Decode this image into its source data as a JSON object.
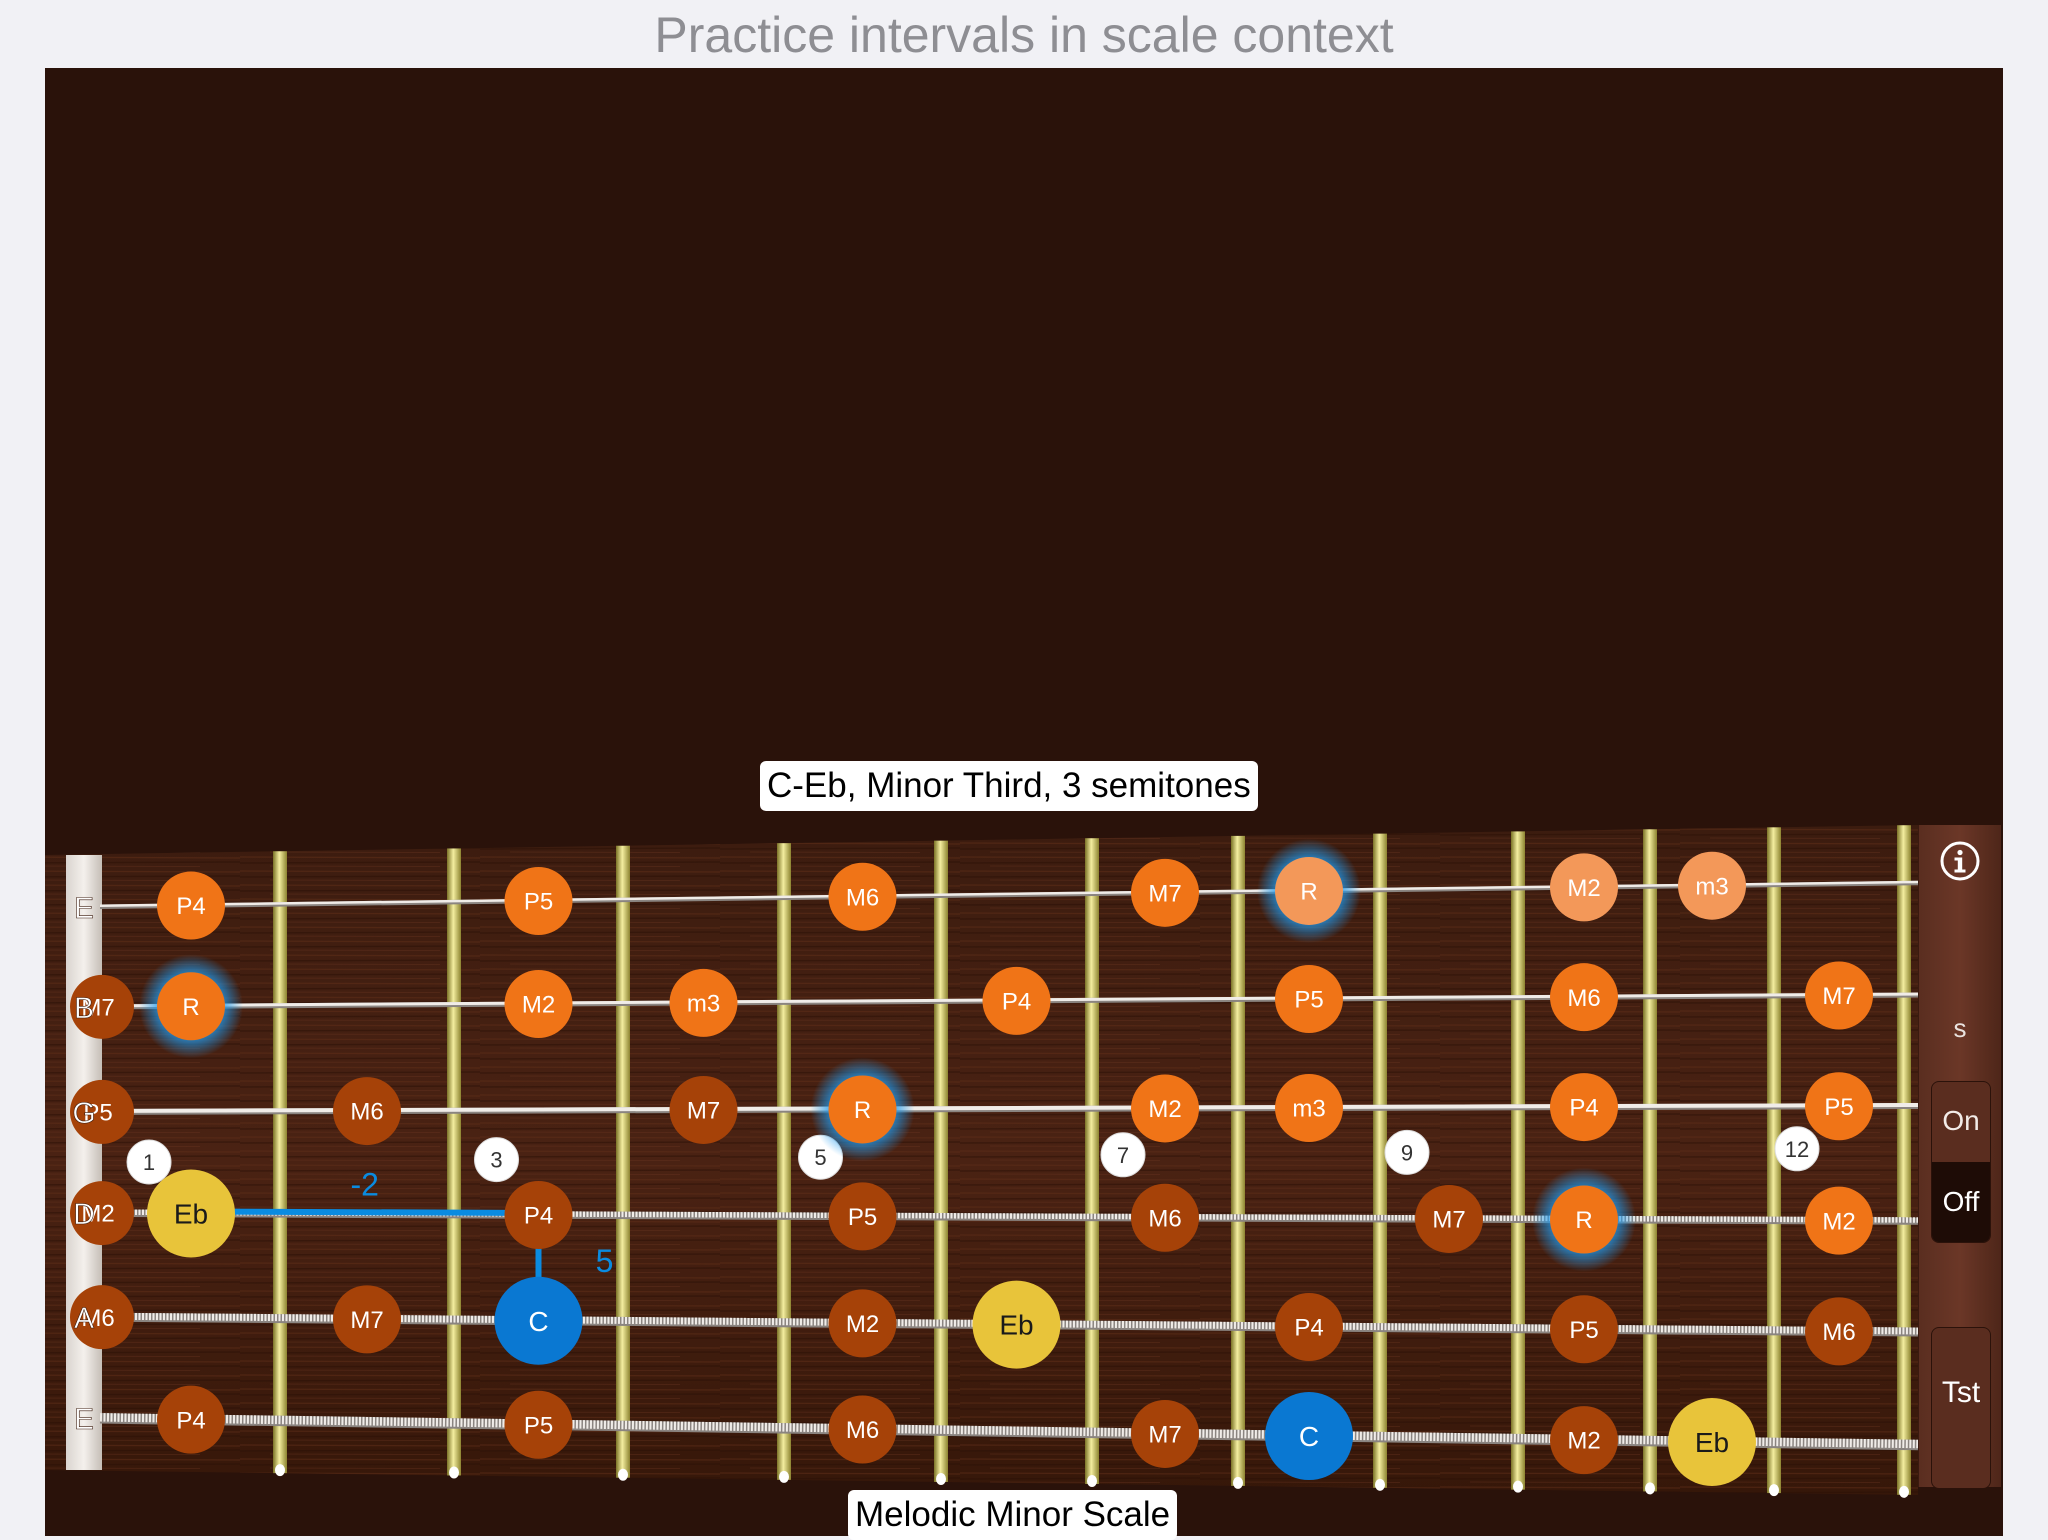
{
  "header": {
    "title": "Practice intervals in scale context"
  },
  "interval_caption": "C-Eb, Minor Third, 3 semitones",
  "scale_caption": "Melodic Minor Scale",
  "strings": [
    {
      "name": "E",
      "notes": [
        {
          "fret": 1,
          "label": "P4",
          "kind": "orange"
        },
        {
          "fret": 3,
          "label": "P5",
          "kind": "orange"
        },
        {
          "fret": 5,
          "label": "M6",
          "kind": "orange"
        },
        {
          "fret": 7,
          "label": "M7",
          "kind": "orange"
        },
        {
          "fret": 8,
          "label": "R",
          "kind": "root-light"
        },
        {
          "fret": 10,
          "label": "M2",
          "kind": "light"
        },
        {
          "fret": 11,
          "label": "m3",
          "kind": "light"
        }
      ]
    },
    {
      "name": "B",
      "notes": [
        {
          "fret": 0,
          "label": "M7",
          "kind": "nut"
        },
        {
          "fret": 1,
          "label": "R",
          "kind": "root"
        },
        {
          "fret": 3,
          "label": "M2",
          "kind": "orange"
        },
        {
          "fret": 4,
          "label": "m3",
          "kind": "orange"
        },
        {
          "fret": 6,
          "label": "P4",
          "kind": "orange"
        },
        {
          "fret": 8,
          "label": "P5",
          "kind": "orange"
        },
        {
          "fret": 10,
          "label": "M6",
          "kind": "orange"
        },
        {
          "fret": 12,
          "label": "M7",
          "kind": "orange"
        }
      ]
    },
    {
      "name": "G",
      "notes": [
        {
          "fret": 0,
          "label": "P5",
          "kind": "nut"
        },
        {
          "fret": 2,
          "label": "M6",
          "kind": "dark"
        },
        {
          "fret": 4,
          "label": "M7",
          "kind": "dark"
        },
        {
          "fret": 5,
          "label": "R",
          "kind": "root"
        },
        {
          "fret": 7,
          "label": "M2",
          "kind": "orange"
        },
        {
          "fret": 8,
          "label": "m3",
          "kind": "orange"
        },
        {
          "fret": 10,
          "label": "P4",
          "kind": "orange"
        },
        {
          "fret": 12,
          "label": "P5",
          "kind": "orange"
        }
      ]
    },
    {
      "name": "D",
      "notes": [
        {
          "fret": 0,
          "label": "M2",
          "kind": "nut"
        },
        {
          "fret": 1,
          "label": "Eb",
          "kind": "yellow"
        },
        {
          "fret": 3,
          "label": "P4",
          "kind": "dark"
        },
        {
          "fret": 5,
          "label": "P5",
          "kind": "dark"
        },
        {
          "fret": 7,
          "label": "M6",
          "kind": "dark"
        },
        {
          "fret": 9,
          "label": "M7",
          "kind": "dark"
        },
        {
          "fret": 10,
          "label": "R",
          "kind": "root"
        },
        {
          "fret": 12,
          "label": "M2",
          "kind": "orange"
        }
      ]
    },
    {
      "name": "A",
      "notes": [
        {
          "fret": 0,
          "label": "M6",
          "kind": "nut"
        },
        {
          "fret": 2,
          "label": "M7",
          "kind": "dark"
        },
        {
          "fret": 3,
          "label": "C",
          "kind": "blue"
        },
        {
          "fret": 5,
          "label": "M2",
          "kind": "dark"
        },
        {
          "fret": 6,
          "label": "Eb",
          "kind": "yellow"
        },
        {
          "fret": 8,
          "label": "P4",
          "kind": "dark"
        },
        {
          "fret": 10,
          "label": "P5",
          "kind": "dark"
        },
        {
          "fret": 12,
          "label": "M6",
          "kind": "dark"
        }
      ]
    },
    {
      "name": "E",
      "notes": [
        {
          "fret": 1,
          "label": "P4",
          "kind": "dark"
        },
        {
          "fret": 3,
          "label": "P5",
          "kind": "dark"
        },
        {
          "fret": 5,
          "label": "M6",
          "kind": "dark"
        },
        {
          "fret": 7,
          "label": "M7",
          "kind": "dark"
        },
        {
          "fret": 8,
          "label": "C",
          "kind": "blue"
        },
        {
          "fret": 10,
          "label": "M2",
          "kind": "dark"
        },
        {
          "fret": 11,
          "label": "Eb",
          "kind": "yellow"
        }
      ]
    }
  ],
  "fret_markers": [
    {
      "fret": 1,
      "label": "1"
    },
    {
      "fret": 3,
      "label": "3"
    },
    {
      "fret": 5,
      "label": "5"
    },
    {
      "fret": 7,
      "label": "7"
    },
    {
      "fret": 9,
      "label": "9"
    },
    {
      "fret": 12,
      "label": "12"
    }
  ],
  "distance_labels": {
    "horizontal": "-2",
    "vertical": "5"
  },
  "side_panel": {
    "info_icon": "info-icon",
    "s_label": "s",
    "toggle_on": "On",
    "toggle_off": "Off",
    "test_label": "Tst"
  },
  "colors": {
    "orange": "#f07417",
    "light": "#f39859",
    "dark": "#a64208",
    "root_glow": "#1e9bf0",
    "yellow": "#e8c43a",
    "blue": "#0a78d2",
    "interval_line": "#0a8be0",
    "background": "#2a120a"
  }
}
